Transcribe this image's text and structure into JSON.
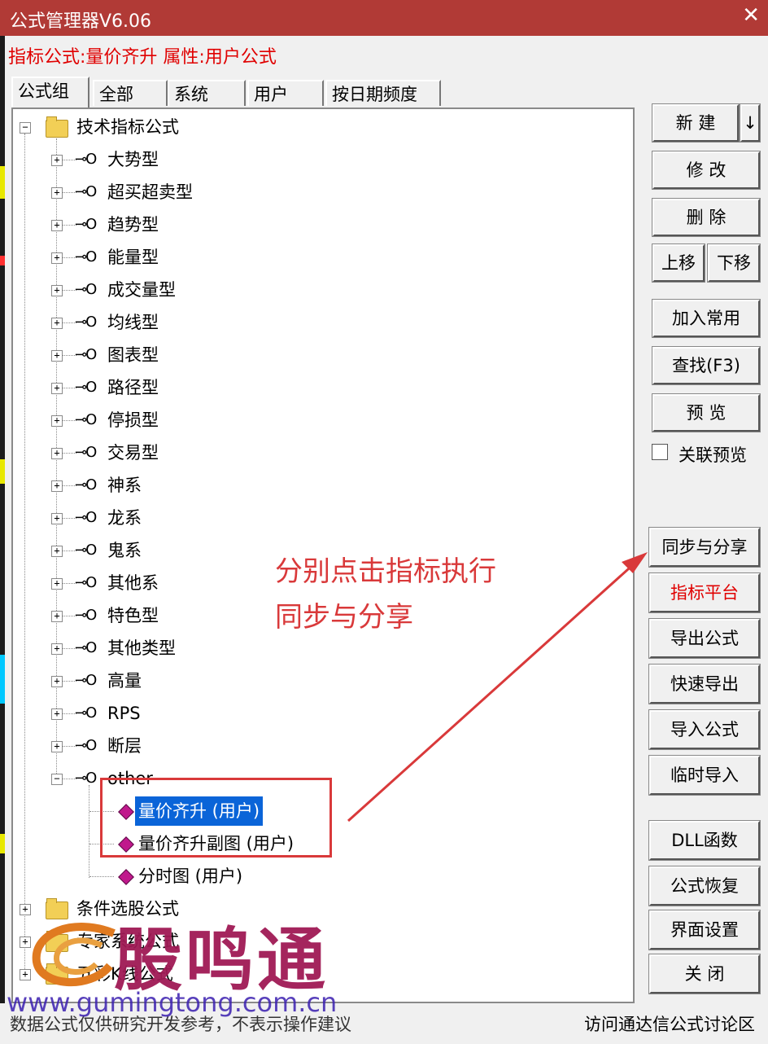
{
  "window": {
    "title": "公式管理器V6.06",
    "close_glyph": "✕"
  },
  "info": "指标公式:量价齐升  属性:用户公式",
  "tabs": [
    "公式组",
    "全部",
    "系统",
    "用户",
    "按日期频度"
  ],
  "tree": {
    "root": "技术指标公式",
    "groups": [
      "大势型",
      "超买超卖型",
      "趋势型",
      "能量型",
      "成交量型",
      "均线型",
      "图表型",
      "路径型",
      "停损型",
      "交易型",
      "神系",
      "龙系",
      "鬼系",
      "其他系",
      "特色型",
      "其他类型",
      "高量",
      "RPS",
      "断层",
      "other"
    ],
    "other_items": [
      "量价齐升  (用户)",
      "量价齐升副图  (用户)",
      "分时图  (用户)"
    ],
    "bottom_roots": [
      "条件选股公式",
      "专家系统公式",
      "五彩K线公式"
    ]
  },
  "buttons": {
    "new": "新  建",
    "new_arrow": "↓",
    "modify": "修  改",
    "delete": "删  除",
    "move_up": "上移",
    "move_down": "下移",
    "add_common": "加入常用",
    "find": "查找(F3)",
    "preview": "预  览",
    "linked_preview": "关联预览",
    "sync_share": "同步与分享",
    "indicator_platform": "指标平台",
    "export": "导出公式",
    "quick_export": "快速导出",
    "import": "导入公式",
    "temp_import": "临时导入",
    "dll": "DLL函数",
    "restore": "公式恢复",
    "ui_settings": "界面设置",
    "close": "关  闭"
  },
  "annotation": {
    "line1": "分别点击指标执行",
    "line2": "同步与分享"
  },
  "status": {
    "left": "数据公式仅供研究开发参考，不表示操作建议",
    "right": "访问通达信公式讨论区"
  },
  "watermark": {
    "name": "股鸣通",
    "url": "www.gumingtong.com.cn"
  },
  "colors": {
    "titlebar": "#b13a36",
    "annotation": "#d9393a",
    "selection": "#0a64d8",
    "platform_text": "#e00000"
  }
}
